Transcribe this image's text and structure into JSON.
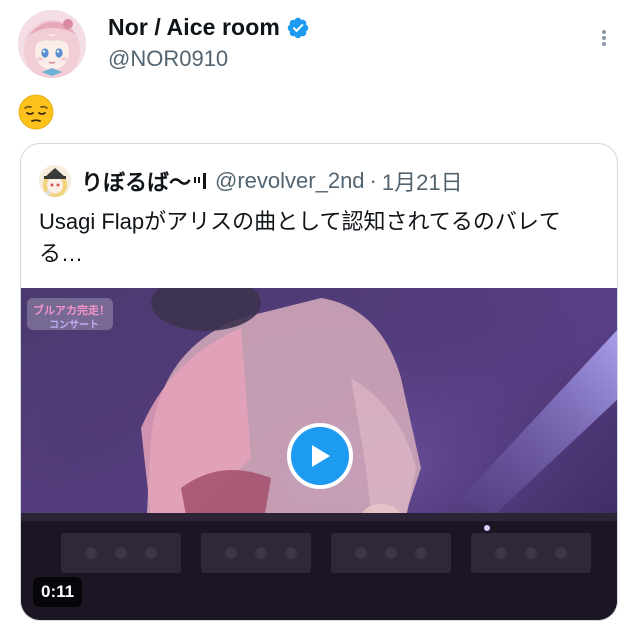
{
  "author": {
    "display_name": "Nor / Aice room",
    "handle": "@NOR0910",
    "verified": true,
    "avatar_icon": "anime-avatar"
  },
  "post": {
    "emoji": "😔",
    "emoji_name": "pensive-face"
  },
  "quoted_post": {
    "display_name": "りぼるば〜",
    "handle": "@revolver_2nd",
    "separator": "·",
    "date": "1月21日",
    "text": "Usagi Flapがアリスの曲として認知されてるのバレてる…"
  },
  "media": {
    "type": "video",
    "duration": "0:11",
    "logo_text": "ブルアカ完走！コンサート"
  },
  "colors": {
    "accent": "#1d9bf0",
    "text_primary": "#0f1419",
    "text_secondary": "#536471",
    "border": "#cfd9de"
  }
}
